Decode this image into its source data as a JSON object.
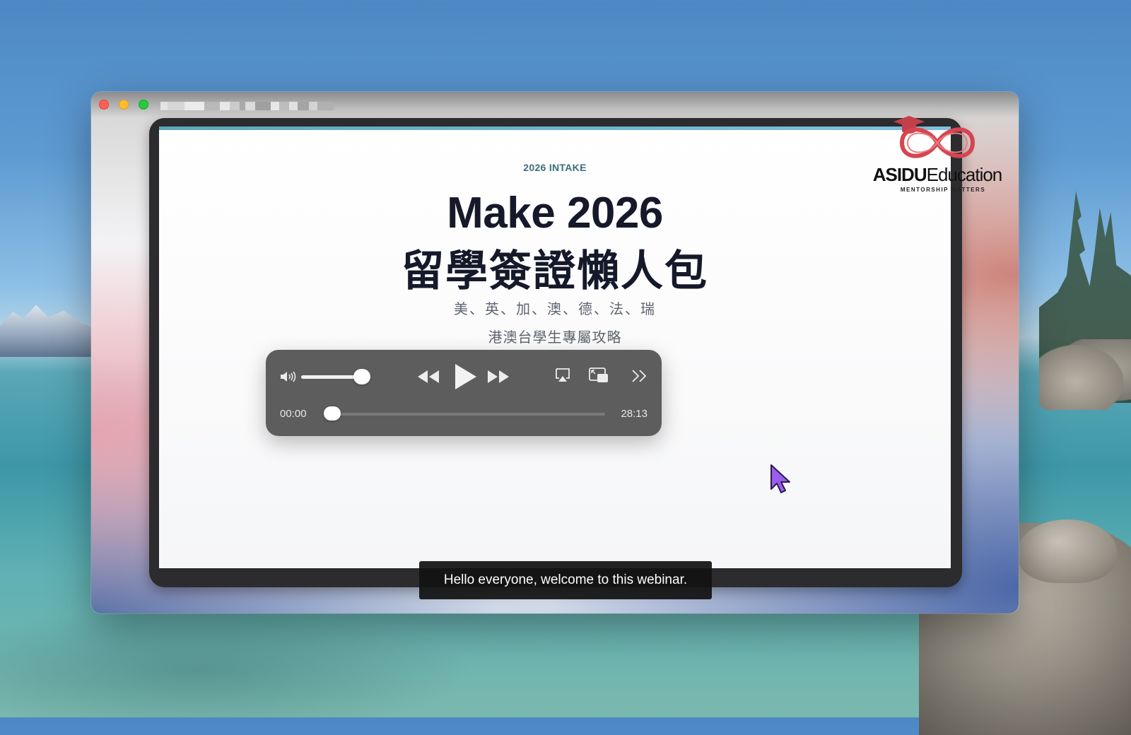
{
  "slide": {
    "eyebrow": "2026 INTAKE",
    "title": "Make 2026",
    "title_zh": "留學簽證懶人包",
    "countries": "美、英、加、澳、德、法、瑞",
    "subtitle": "港澳台學生專屬攻略"
  },
  "logo": {
    "brand_bold": "ASIDU",
    "brand_light": "Education",
    "tagline": "MENTORSHIP MATTERS",
    "color": "#d64550"
  },
  "player": {
    "current_time": "00:00",
    "duration": "28:13",
    "volume": 0.85,
    "progress": 0.0,
    "icons": [
      "volume-icon",
      "rewind-icon",
      "play-icon",
      "fast-forward-icon",
      "airplay-icon",
      "picture-in-picture-icon",
      "more-icon"
    ]
  },
  "caption": {
    "text": "Hello everyone, welcome to this webinar."
  },
  "colors": {
    "close": "#ff5f57",
    "minimize": "#febc2e",
    "maximize": "#28c840",
    "cursor": "#9b5cf0"
  }
}
